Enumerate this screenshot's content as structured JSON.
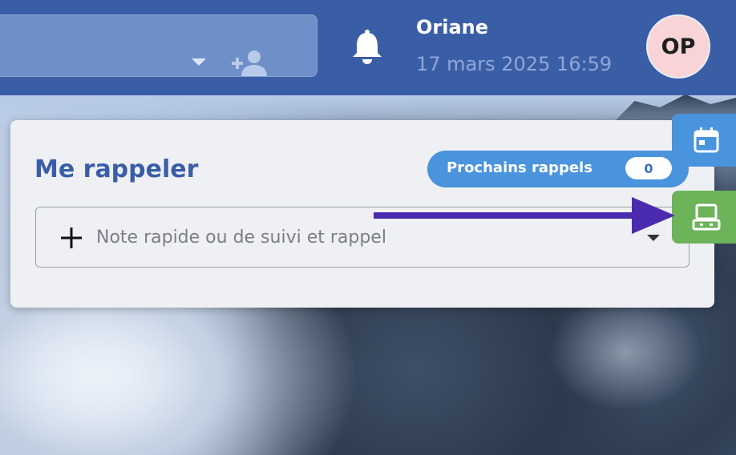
{
  "header": {
    "user_name": "Oriane",
    "datetime": "17 mars 2025 16:59",
    "avatar_initials": "OP",
    "icons": [
      "chevron-down-icon",
      "add-person-icon",
      "bell-icon"
    ]
  },
  "reminder_card": {
    "title": "Me rappeler",
    "upcoming_label": "Prochains rappels",
    "upcoming_count": "0",
    "quick_note_placeholder": "Note rapide ou de suivi et rappel"
  },
  "side_tabs": [
    {
      "name": "calendar",
      "icon": "calendar-icon",
      "color": "#4a93dd"
    },
    {
      "name": "register",
      "icon": "cash-register-icon",
      "color": "#6cb35a"
    }
  ],
  "colors": {
    "topbar": "#3a5ea6",
    "title": "#3a5ea6",
    "pill": "#4a93dd",
    "arrow": "#4a2bb0"
  }
}
